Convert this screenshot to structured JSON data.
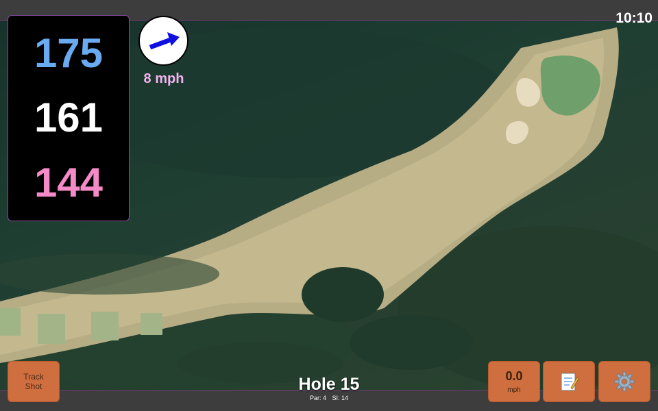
{
  "status_bar": {
    "time": "10:10"
  },
  "distances": {
    "back": "175",
    "center": "161",
    "front": "144"
  },
  "wind": {
    "speed_label": "8 mph",
    "direction_icon": "wind-arrow-icon"
  },
  "speed": {
    "value": "0.0",
    "unit": "mph"
  },
  "buttons": {
    "track_shot": "Track\nShot",
    "notes_icon": "notepad-icon",
    "settings_icon": "gear-icon"
  },
  "hole": {
    "title": "Hole 15",
    "par": "Par: 4",
    "si": "SI: 14"
  },
  "colors": {
    "back": "#69aaf0",
    "center": "#ffffff",
    "front": "#f58ac8",
    "button": "#cf6e3e",
    "wind_label": "#f3b3f0",
    "arrow": "#1010e0"
  }
}
